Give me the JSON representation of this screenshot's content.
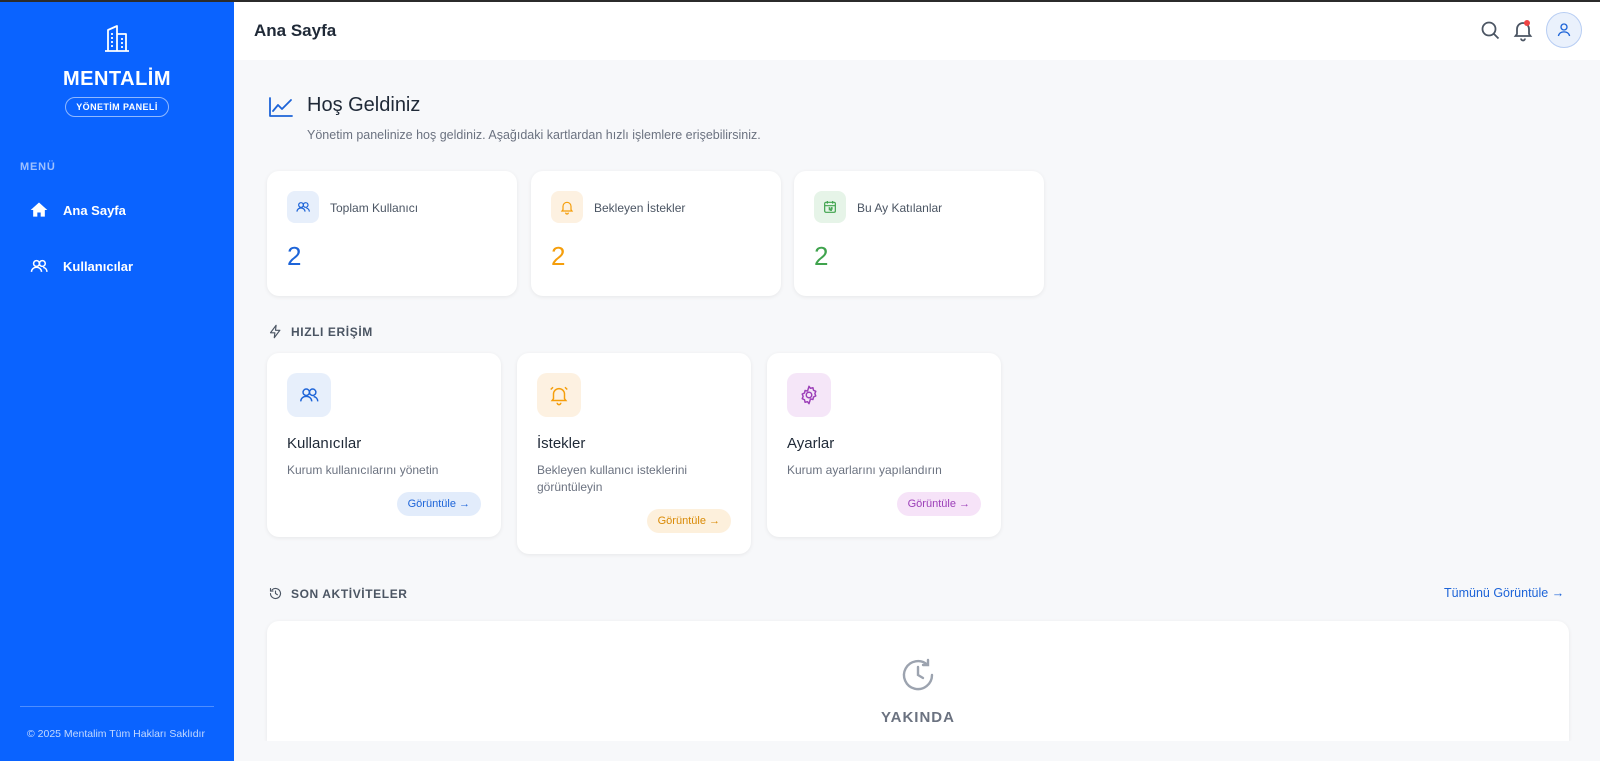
{
  "colors": {
    "sidebar": "#0a63ff",
    "blue": "#1d64d8",
    "orange": "#f59e0b",
    "green": "#3fa34d",
    "purple": "#9c3fb8"
  },
  "sidebar": {
    "brand_icon": "building-icon",
    "brand_name": "MENTALİM",
    "brand_badge": "YÖNETİM PANELİ",
    "menu_title": "MENÜ",
    "items": [
      {
        "label": "Ana Sayfa",
        "icon": "home-icon",
        "active": true
      },
      {
        "label": "Kullanıcılar",
        "icon": "users-icon",
        "active": false
      }
    ],
    "footer": "© 2025 Mentalim Tüm Hakları Saklıdır"
  },
  "header": {
    "title": "Ana Sayfa",
    "icons": [
      "search-icon",
      "bell-icon",
      "user-icon"
    ]
  },
  "welcome": {
    "icon": "chart-line-icon",
    "title": "Hoş Geldiniz",
    "subtitle": "Yönetim panelinize hoş geldiniz. Aşağıdaki kartlardan hızlı işlemlere erişebilirsiniz."
  },
  "stats": [
    {
      "label": "Toplam Kullanıcı",
      "value": "2",
      "icon": "users-icon",
      "color": "#1d64d8"
    },
    {
      "label": "Bekleyen İstekler",
      "value": "2",
      "icon": "bell-icon",
      "color": "#f59e0b"
    },
    {
      "label": "Bu Ay Katılanlar",
      "value": "2",
      "icon": "calendar-icon",
      "color": "#3fa34d"
    }
  ],
  "quick_access": {
    "title": "HIZLI ERİŞİM",
    "icon": "lightning-icon",
    "cards": [
      {
        "title": "Kullanıcılar",
        "description": "Kurum kullanıcılarını yönetin",
        "button": "Görüntüle →",
        "icon": "users-icon"
      },
      {
        "title": "İstekler",
        "description": "Bekleyen kullanıcı isteklerini görüntüleyin",
        "button": "Görüntüle →",
        "icon": "alarm-icon"
      },
      {
        "title": "Ayarlar",
        "description": "Kurum ayarlarını yapılandırın",
        "button": "Görüntüle →",
        "icon": "gear-icon"
      }
    ]
  },
  "recent_activities": {
    "title": "SON AKTİVİTELER",
    "icon": "history-icon",
    "see_all": "Tümünü Görüntüle →",
    "placeholder_icon": "clock-icon",
    "placeholder_title": "YAKINDA"
  }
}
